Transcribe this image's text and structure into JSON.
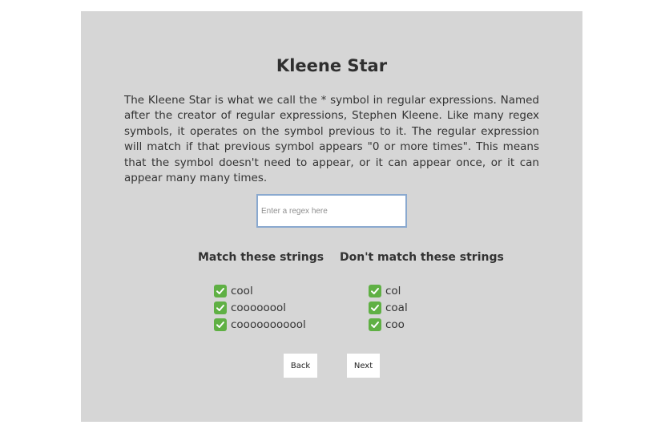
{
  "lesson": {
    "title": "Kleene Star",
    "description": "The Kleene Star is what we call the * symbol in regular expressions. Named after the creator of regular expressions, Stephen Kleene. Like many regex symbols, it operates on the symbol previous to it. The regular expression will match if that previous symbol appears \"0 or more times\". This means that the symbol doesn't need to appear, or it can appear once, or it can appear many many times."
  },
  "regex_input": {
    "placeholder": "Enter a regex here",
    "value": ""
  },
  "match": {
    "heading": "Match these strings",
    "items": [
      "cool",
      "coooooool",
      "cooooooooool"
    ]
  },
  "no_match": {
    "heading": "Don't match these strings",
    "items": [
      "col",
      "coal",
      "coo"
    ]
  },
  "buttons": {
    "back": "Back",
    "next": "Next"
  },
  "colors": {
    "panel_bg": "#d6d6d6",
    "check_green": "#5fb044",
    "input_border": "#8aa9cf"
  },
  "icons": {
    "status": "check-mark-icon"
  }
}
